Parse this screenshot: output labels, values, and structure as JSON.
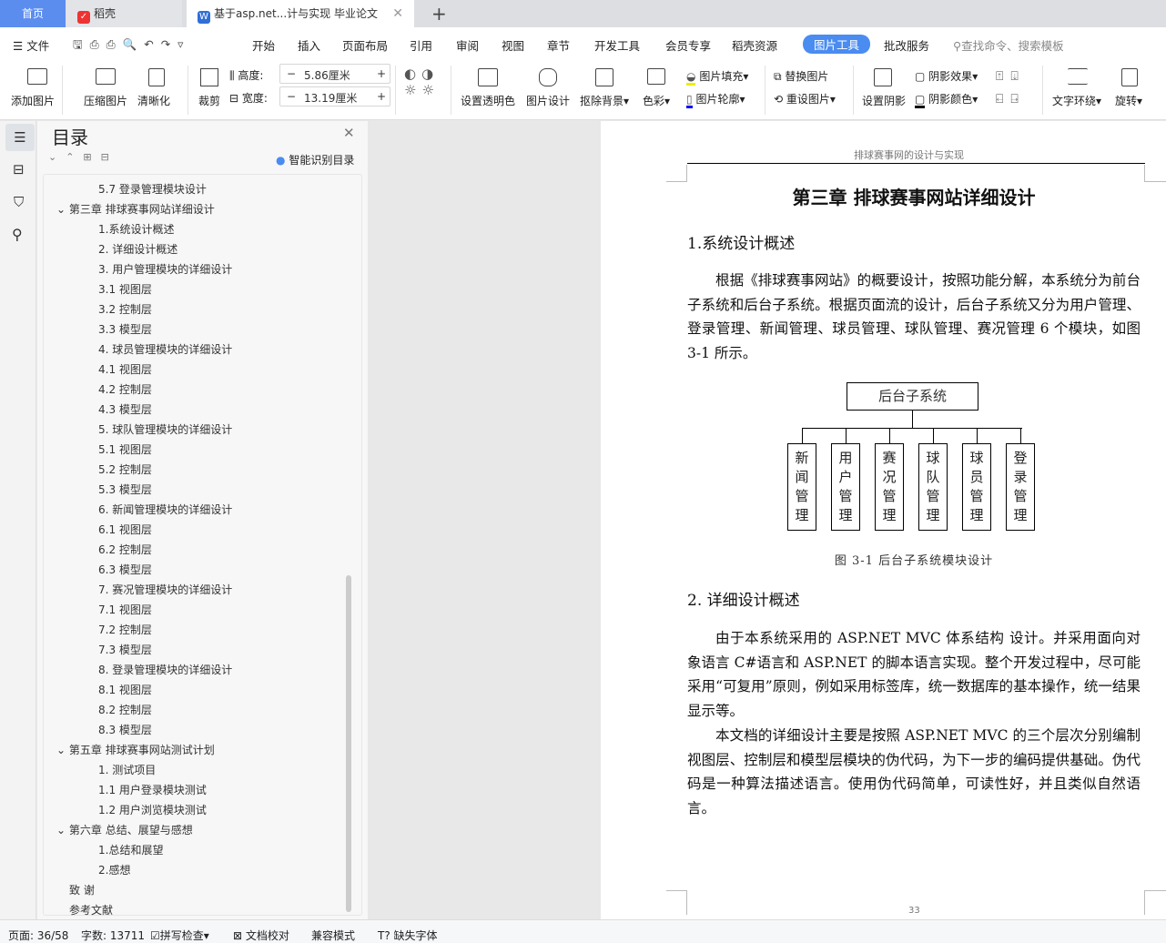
{
  "tabs": {
    "home": "首页",
    "daoke": "稻壳",
    "doc": "基于asp.net...计与实现 毕业论文"
  },
  "menu": {
    "file": "文件",
    "items": [
      "开始",
      "插入",
      "页面布局",
      "引用",
      "审阅",
      "视图",
      "章节",
      "开发工具",
      "会员专享",
      "稻壳资源",
      "图片工具",
      "批改服务"
    ],
    "search_placeholder": "查找命令、搜索模板"
  },
  "ribbon": {
    "add_pic": "添加图片",
    "compress": "压缩图片",
    "clarity": "清晰化",
    "crop": "裁剪",
    "height_label": "高度:",
    "height_value": "5.86厘米",
    "width_label": "宽度:",
    "width_value": "13.19厘米",
    "transparent": "设置透明色",
    "pic_design": "图片设计",
    "remove_bg": "抠除背景",
    "color": "色彩",
    "pic_fill": "图片填充",
    "pic_outline": "图片轮廓",
    "replace": "替换图片",
    "reset": "重设图片",
    "shadow": "设置阴影",
    "shadow_effect": "阴影效果",
    "shadow_color": "阴影颜色",
    "wrap": "文字环绕",
    "rotate": "旋转"
  },
  "toc": {
    "title": "目录",
    "smart": "智能识别目录",
    "items": [
      {
        "t": "5.7  登录管理模块设计",
        "l": 2
      },
      {
        "t": "第三章  排球赛事网站详细设计",
        "l": 1
      },
      {
        "t": "1.系统设计概述",
        "l": 2
      },
      {
        "t": "2.  详细设计概述",
        "l": 2
      },
      {
        "t": "3.  用户管理模块的详细设计",
        "l": 2
      },
      {
        "t": "3.1  视图层",
        "l": 2
      },
      {
        "t": "3.2  控制层",
        "l": 2
      },
      {
        "t": "3.3  模型层",
        "l": 2
      },
      {
        "t": "4.  球员管理模块的详细设计",
        "l": 2
      },
      {
        "t": "4.1 视图层",
        "l": 2
      },
      {
        "t": "4.2  控制层",
        "l": 2
      },
      {
        "t": "4.3  模型层",
        "l": 2
      },
      {
        "t": "5.  球队管理模块的详细设计",
        "l": 2
      },
      {
        "t": "5.1 视图层",
        "l": 2
      },
      {
        "t": "5.2  控制层",
        "l": 2
      },
      {
        "t": "5.3  模型层",
        "l": 2
      },
      {
        "t": "6.  新闻管理模块的详细设计",
        "l": 2
      },
      {
        "t": "6.1 视图层",
        "l": 2
      },
      {
        "t": "6.2  控制层",
        "l": 2
      },
      {
        "t": "6.3  模型层",
        "l": 2
      },
      {
        "t": "7.  赛况管理模块的详细设计",
        "l": 2
      },
      {
        "t": "7.1 视图层",
        "l": 2
      },
      {
        "t": "7.2  控制层",
        "l": 2
      },
      {
        "t": "7.3  模型层",
        "l": 2
      },
      {
        "t": "8.  登录管理模块的详细设计",
        "l": 2
      },
      {
        "t": "8.1 视图层",
        "l": 2
      },
      {
        "t": "8.2  控制层",
        "l": 2
      },
      {
        "t": "8.3  模型层",
        "l": 2
      },
      {
        "t": "第五章  排球赛事网站测试计划",
        "l": 1
      },
      {
        "t": "1.  测试项目",
        "l": 2
      },
      {
        "t": "1.1  用户登录模块测试",
        "l": 2
      },
      {
        "t": "1.2  用户浏览模块测试",
        "l": 2
      },
      {
        "t": "第六章  总结、展望与感想",
        "l": 1
      },
      {
        "t": "1.总结和展望",
        "l": 2
      },
      {
        "t": "2.感想",
        "l": 2
      },
      {
        "t": "致  谢",
        "l": 0
      },
      {
        "t": "参考文献",
        "l": 0
      }
    ]
  },
  "doc": {
    "header": "排球赛事网的设计与实现",
    "chapter": "第三章  排球赛事网站详细设计",
    "h1": "1.系统设计概述",
    "p1": "根据《排球赛事网站》的概要设计，按照功能分解，本系统分为前台子系统和后台子系统。根据页面流的设计，后台子系统又分为用户管理、登录管理、新闻管理、球员管理、球队管理、赛况管理 6 个模块，如图 3-1 所示。",
    "diagram": {
      "root": "后台子系统",
      "children": [
        "新闻管理",
        "用户管理",
        "赛况管理",
        "球队管理",
        "球员管理",
        "登录管理"
      ]
    },
    "caption": "图 3-1    后台子系统模块设计",
    "h2": "2.  详细设计概述",
    "p2": "由于本系统采用的 ASP.NET MVC 体系结构  设计。并采用面向对象语言 C#语言和 ASP.NET 的脚本语言实现。整个开发过程中，尽可能采用“可复用”原则，例如采用标签库，统一数据库的基本操作，统一结果显示等。",
    "p3": "本文档的详细设计主要是按照 ASP.NET MVC 的三个层次分别编制视图层、控制层和模型层模块的伪代码，为下一步的编码提供基础。伪代码是一种算法描述语言。使用伪代码简单，可读性好，并且类似自然语言。",
    "page_number": "33"
  },
  "status": {
    "page": "页面: 36/58",
    "words": "字数: 13711",
    "spell": "拼写检查",
    "proof": "文档校对",
    "compat": "兼容模式",
    "missing_font": "缺失字体"
  },
  "colors": {
    "accent": "#4a8cf0",
    "home_tab": "#5b8def"
  }
}
